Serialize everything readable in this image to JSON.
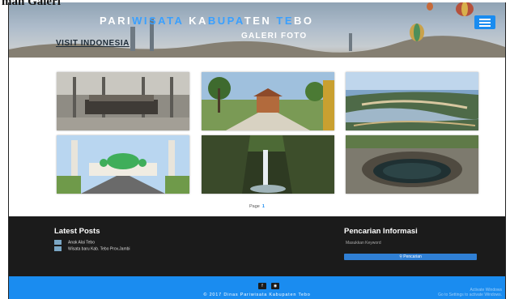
{
  "document": {
    "heading": "man Galeri"
  },
  "header": {
    "title_parts": [
      "PARI",
      "WISATA",
      " KA",
      "BUPA",
      "TEN ",
      "TE",
      "BO"
    ],
    "subtitle": "GALERI FOTO",
    "tagline": "VISIT INDONESIA",
    "menu_icon": "hamburger-menu-icon",
    "accent_color": "#1a8cf0"
  },
  "gallery": {
    "photos": [
      {
        "subject": "monument-pavilion"
      },
      {
        "subject": "park-gateway"
      },
      {
        "subject": "aerial-river-landscape"
      },
      {
        "subject": "mosque"
      },
      {
        "subject": "waterfall"
      },
      {
        "subject": "sinkhole-pond"
      }
    ],
    "pager": {
      "label": "Page",
      "current": "1"
    }
  },
  "latest_posts": {
    "title": "Latest Posts",
    "items": [
      "Anak Alai Tebo",
      "Wisata baru Kab. Tebo Prov.Jambi"
    ]
  },
  "search": {
    "title": "Pencarian Informasi",
    "placeholder": "Masukkan Keyword",
    "button_label": "Pencarian"
  },
  "footer": {
    "social": [
      {
        "icon": "facebook-icon",
        "glyph": "f"
      },
      {
        "icon": "instagram-icon",
        "glyph": "◉"
      }
    ],
    "copyright": "© 2017 Dinas Pariwisata Kabupaten Tebo",
    "watermark_line1": "Activate Windows",
    "watermark_line2": "Go to Settings to activate Windows."
  }
}
